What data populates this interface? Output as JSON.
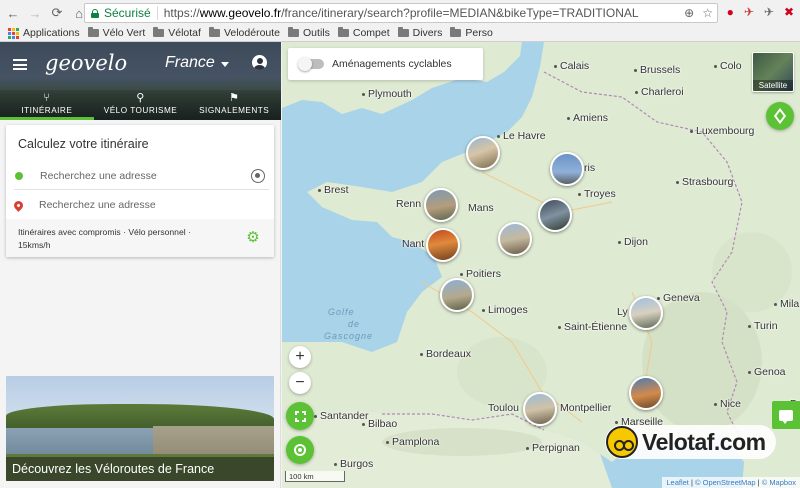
{
  "browser": {
    "secure_label": "Sécurisé",
    "url_scheme": "https://",
    "url_host": "www.geovelo.fr",
    "url_path": "/france/itinerary/search?profile=MEDIAN&bikeType=TRADITIONAL",
    "bookmarks": [
      {
        "label": "Applications",
        "icon": "apps-grid-icon"
      },
      {
        "label": "Vélo Vert",
        "icon": "folder-icon"
      },
      {
        "label": "Vélotaf",
        "icon": "folder-icon"
      },
      {
        "label": "Velodéroute",
        "icon": "folder-icon"
      },
      {
        "label": "Outils",
        "icon": "folder-icon"
      },
      {
        "label": "Compet",
        "icon": "folder-icon"
      },
      {
        "label": "Divers",
        "icon": "folder-icon"
      },
      {
        "label": "Perso",
        "icon": "folder-icon"
      }
    ]
  },
  "header": {
    "logo": "geovelo",
    "region": "France",
    "tabs": [
      {
        "label": "ITINÉRAIRE",
        "icon": "fork-arrows-icon",
        "active": true
      },
      {
        "label": "VÉLO TOURISME",
        "icon": "bike-icon",
        "active": false
      },
      {
        "label": "SIGNALEMENTS",
        "icon": "report-flag-icon",
        "active": false
      }
    ]
  },
  "itinerary": {
    "title": "Calculez votre itinéraire",
    "start_placeholder": "Recherchez une adresse",
    "end_placeholder": "Recherchez une adresse",
    "options_line1": "Itinéraires avec compromis · Vélo personnel ·",
    "options_line2": "15kms/h"
  },
  "promo": {
    "caption": "Découvrez les Véloroutes de France"
  },
  "map": {
    "toggle_label": "Aménagements cyclables",
    "satellite_label": "Satellite",
    "zoom_in": "+",
    "zoom_out": "−",
    "scale_label": "100 km",
    "attribution_leaflet": "Leaflet",
    "attribution_osm": "© OpenStreetMap",
    "attribution_mapbox": "© Mapbox",
    "watermark": "Velotaf.com",
    "labels": {
      "plymouth": "Plymouth",
      "calais": "Calais",
      "brussels": "Brussels",
      "cologne": "Colo",
      "charleroi": "Charleroi",
      "amiens": "Amiens",
      "luxembourg": "Luxembourg",
      "le_havre": "Le Havre",
      "paris": "ris",
      "brest": "Brest",
      "reims_troyes": "Troyes",
      "strasbourg": "Strasbourg",
      "rennes": "Renn",
      "le_mans": "Mans",
      "nantes": "Nant",
      "dijon": "Dijon",
      "poitiers": "Poitiers",
      "geneva": "Geneva",
      "limoges": "Limoges",
      "lyon": "Ly",
      "saint_etienne": "Saint-Étienne",
      "milan": "Mila",
      "turin": "Turin",
      "bordeaux": "Bordeaux",
      "santander": "Santander",
      "bilbao": "Bilbao",
      "toulouse": "Toulou",
      "montpellier": "Montpellier",
      "marseille": "Marseille",
      "nice": "Nice",
      "genoa": "Genoa",
      "bologna": "Bo",
      "pamplona": "Pamplona",
      "perpignan": "Perpignan",
      "burgos": "Burgos",
      "sea_golfe": "Golfe",
      "sea_de": "de",
      "sea_gascogne": "Gascogne"
    }
  }
}
